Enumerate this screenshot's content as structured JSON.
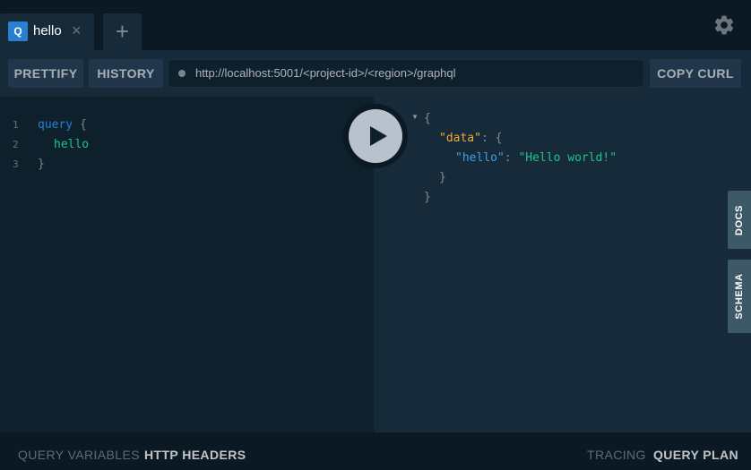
{
  "tabs": [
    {
      "badge": "Q",
      "title": "hello",
      "close": "×"
    }
  ],
  "new_tab": "+",
  "toolbar": {
    "prettify": "PRETTIFY",
    "history": "HISTORY",
    "url": "http://localhost:5001/<project-id>/<region>/graphql",
    "copy_curl": "COPY CURL"
  },
  "editor": {
    "line_numbers": [
      "1",
      "2",
      "3"
    ],
    "query_keyword": "query",
    "open_brace": "{",
    "field": "hello",
    "close_brace": "}"
  },
  "result": {
    "open_brace": "{",
    "data_key": "\"data\"",
    "colon_brace": ": {",
    "hello_key": "\"hello\"",
    "colon": ":",
    "hello_value": "\"Hello world!\"",
    "inner_close": "}",
    "outer_close": "}"
  },
  "side_tabs": {
    "docs": "DOCS",
    "schema": "SCHEMA"
  },
  "bottom": {
    "query_variables": "QUERY VARIABLES",
    "http_headers": "HTTP HEADERS",
    "tracing": "TRACING",
    "query_plan": "QUERY PLAN"
  },
  "colors": {
    "accent": "#2a7ed3",
    "field": "#1ec38b",
    "json_key_data": "#f2a93b",
    "json_key_hello": "#3ea0e4"
  },
  "icons": [
    "settings-gear-icon",
    "play-icon",
    "status-dot-icon"
  ]
}
